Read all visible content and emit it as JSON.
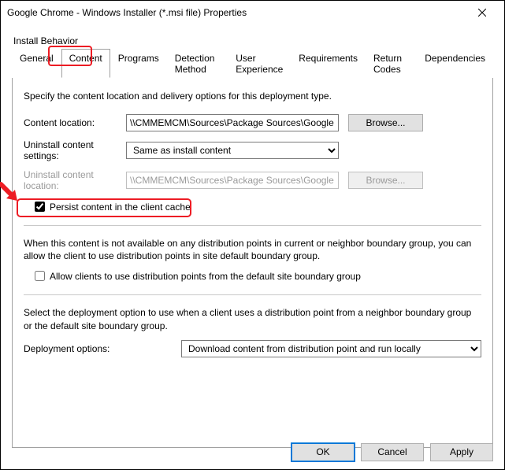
{
  "window": {
    "title": "Google Chrome - Windows Installer (*.msi file) Properties"
  },
  "upper_label": "Install Behavior",
  "tabs": {
    "general": "General",
    "content": "Content",
    "programs": "Programs",
    "detection": "Detection Method",
    "userexp": "User Experience",
    "requirements": "Requirements",
    "returncodes": "Return Codes",
    "dependencies": "Dependencies"
  },
  "panel": {
    "desc": "Specify the content location and delivery options for this deployment type.",
    "content_location_label": "Content location:",
    "content_location_value": "\\\\CMMEMCM\\Sources\\Package Sources\\Google Chrome\\",
    "browse": "Browse...",
    "uninstall_settings_label": "Uninstall content settings:",
    "uninstall_settings_value": "Same as install content",
    "uninstall_location_label": "Uninstall content location:",
    "uninstall_location_value": "\\\\CMMEMCM\\Sources\\Package Sources\\Google Chrome\\",
    "persist_label": "Persist content in the client cache",
    "fallback_para": "When this content is not available on any distribution points in current or neighbor boundary group, you can allow the client to use distribution points in site default boundary group.",
    "allow_fallback_label": "Allow clients to use distribution points from the default site boundary group",
    "deploy_para": "Select the deployment option to use when a client uses a distribution point from a neighbor boundary group or the default site boundary group.",
    "deploy_label": "Deployment options:",
    "deploy_value": "Download content from distribution point and run locally"
  },
  "buttons": {
    "ok": "OK",
    "cancel": "Cancel",
    "apply": "Apply"
  }
}
